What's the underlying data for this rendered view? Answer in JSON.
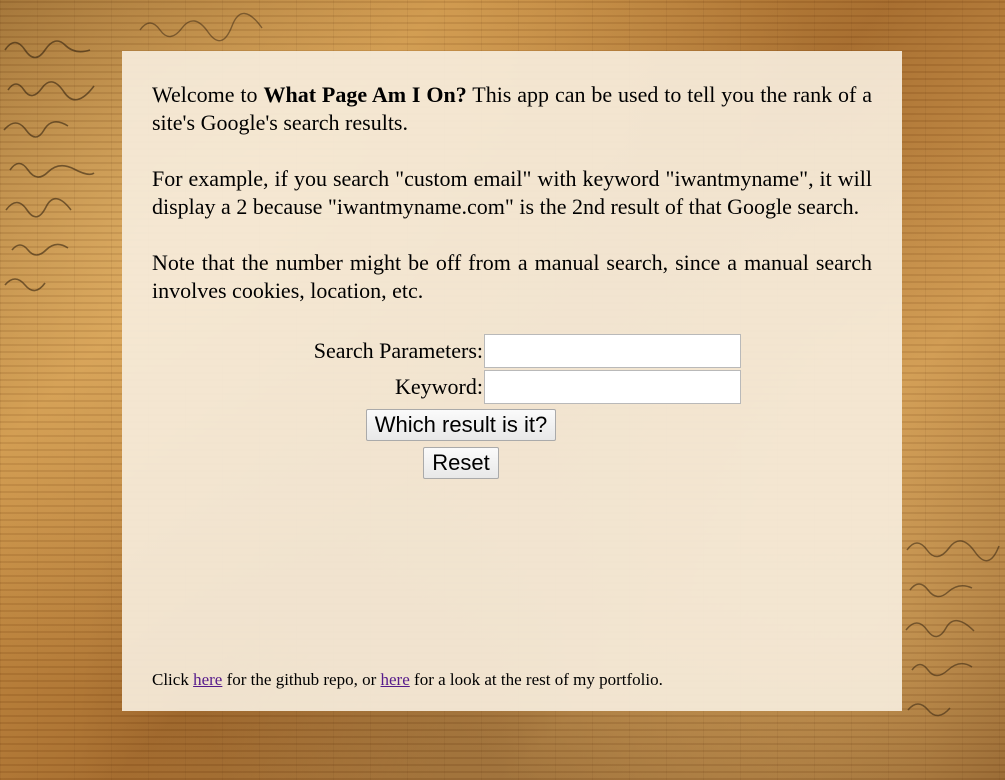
{
  "intro": {
    "p1_prefix": "Welcome to ",
    "app_name": "What Page Am I On?",
    "p1_suffix": " This app can be used to tell you the rank of a site's Google's search results.",
    "p2": "For example, if you search \"custom email\" with keyword \"iwantmyname\", it will display a 2 because \"iwantmyname.com\" is the 2nd result of that Google search.",
    "p3": "Note that the number might be off from a manual search, since a manual search involves cookies, location, etc."
  },
  "form": {
    "search_label": "Search Parameters:",
    "search_value": "",
    "keyword_label": "Keyword:",
    "keyword_value": "",
    "submit_label": "Which result is it?",
    "reset_label": "Reset"
  },
  "footer": {
    "text_1": "Click ",
    "link_1": "here",
    "text_2": " for the github repo, or ",
    "link_2": "here",
    "text_3": " for a look at the rest of my portfolio."
  },
  "colors": {
    "panel_background": "#f6ecda",
    "link_visited": "#551a8b",
    "wood_background": "#c48a3f"
  }
}
